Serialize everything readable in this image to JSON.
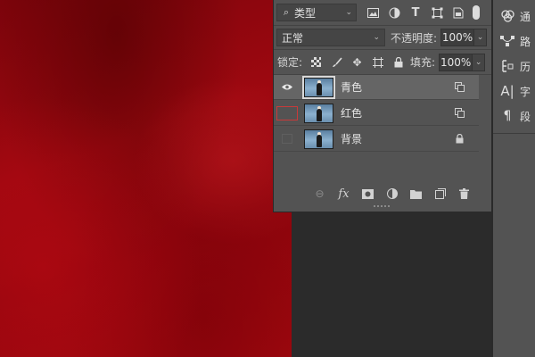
{
  "layers_panel": {
    "filter": {
      "selected": "类型",
      "icons": [
        "image-filter-icon",
        "adjustment-filter-icon",
        "type-filter-icon",
        "shape-filter-icon",
        "smart-object-filter-icon"
      ]
    },
    "blend_mode": "正常",
    "opacity_label": "不透明度:",
    "opacity_value": "100%",
    "lock_label": "锁定:",
    "fill_label": "填充:",
    "fill_value": "100%",
    "layers": [
      {
        "name": "青色",
        "visible": true,
        "selected": true,
        "badge": "group-link-icon"
      },
      {
        "name": "红色",
        "visible": false,
        "selected": false,
        "badge": "group-link-icon"
      },
      {
        "name": "背景",
        "visible": false,
        "selected": false,
        "badge": "lock-icon"
      }
    ],
    "bottom_bar": [
      "link-layers-icon",
      "fx-icon",
      "add-mask-icon",
      "adjustment-layer-icon",
      "new-group-icon",
      "new-layer-icon",
      "delete-icon"
    ],
    "fx_label": "fx"
  },
  "right_panel": {
    "items": [
      {
        "label": "通",
        "icon": "channels-icon"
      },
      {
        "label": "路",
        "icon": "paths-icon"
      },
      {
        "label": "历",
        "icon": "history-icon"
      },
      {
        "label": "字",
        "icon": "character-icon"
      },
      {
        "label": "段",
        "icon": "paragraph-icon"
      }
    ]
  },
  "colors": {
    "canvas_red": "#9d0810",
    "panel": "#535353",
    "selected_layer": "#656565",
    "dark_bg": "#2b2b2b"
  }
}
